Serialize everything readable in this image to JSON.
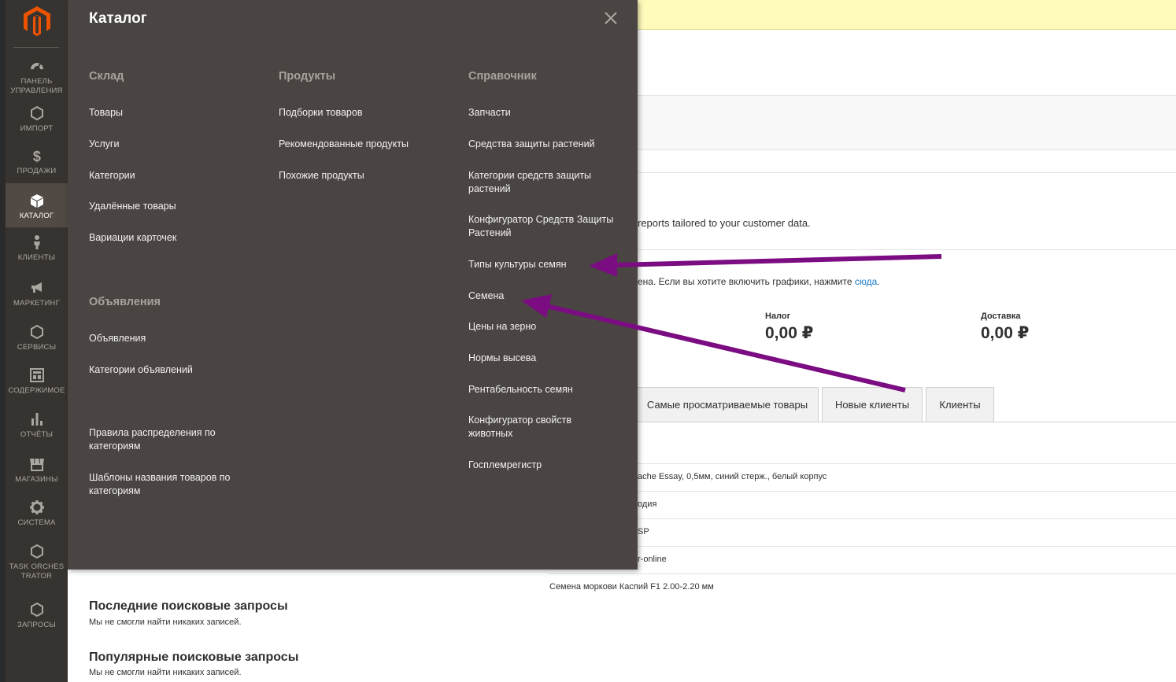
{
  "sidebar": {
    "logo_icon": "magento-logo-icon",
    "items": [
      {
        "label": "Панель управления",
        "icon": "dashboard-icon"
      },
      {
        "label": "Импорт",
        "icon": "hexagon-icon"
      },
      {
        "label": "Продажи",
        "icon": "dollar-icon"
      },
      {
        "label": "Каталог",
        "icon": "box-icon",
        "active": true
      },
      {
        "label": "Клиенты",
        "icon": "person-icon"
      },
      {
        "label": "Маркетинг",
        "icon": "megaphone-icon"
      },
      {
        "label": "Сервисы",
        "icon": "hexagon-icon"
      },
      {
        "label": "Содержимое",
        "icon": "layout-icon"
      },
      {
        "label": "Отчёты",
        "icon": "bar-chart-icon"
      },
      {
        "label": "Магазины",
        "icon": "store-icon"
      },
      {
        "label": "Система",
        "icon": "gear-icon"
      },
      {
        "label": "Task Orchestrator",
        "icon": "hexagon-icon"
      },
      {
        "label": "Запросы",
        "icon": "hexagon-icon"
      }
    ],
    "accent_color": "#eb5202"
  },
  "flyout": {
    "title": "Каталог",
    "close_icon": "close-icon",
    "columns": [
      {
        "heading": "Склад",
        "links": [
          "Товары",
          "Услуги",
          "Категории",
          "Удалённые товары",
          "Вариации карточек"
        ]
      },
      {
        "heading": "Продукты",
        "links": [
          "Подборки товаров",
          "Рекомендованные продукты",
          "Похожие продукты"
        ]
      },
      {
        "heading": "Справочник",
        "links": [
          "Запчасти",
          "Средства защиты растений",
          "Категории средств защиты растений",
          "Конфигуратор Средств Защиты Растений",
          "Типы культуры семян",
          "Семена",
          "Цены на зерно",
          "Нормы высева",
          "Рентабельность семян",
          "Конфигуратор свойств животных",
          "Госплемрегистр"
        ]
      }
    ],
    "ads": {
      "heading": "Объявления",
      "links": [
        "Объявления",
        "Категории объявлений"
      ]
    },
    "extra_links": [
      "Правила распределения по категориям",
      "Шаблоны названия товаров по категориям"
    ]
  },
  "dashboard": {
    "reports_text": "reports tailored to your customer data.",
    "charts_notice_prefix": "ена. Если вы хотите включить графики, нажмите ",
    "charts_notice_link": "сюда",
    "charts_notice_suffix": ".",
    "stats": [
      {
        "label": "Налог",
        "value": "0,00 ₽"
      },
      {
        "label": "Доставка",
        "value": "0,00 ₽"
      }
    ],
    "tabs": [
      "Самые просматриваемые товары",
      "Новые клиенты",
      "Клиенты"
    ],
    "rows": [
      "ache Essay, 0,5мм, синий стерж., белый корпус",
      "одия",
      "SP",
      "r-online",
      "Семена моркови Каспий F1 2.00-2.20 мм"
    ],
    "last_search_title": "Последние поисковые запросы",
    "last_search_empty": "Мы не смогли найти никаких записей.",
    "popular_search_title": "Популярные поисковые запросы",
    "popular_search_empty": "Мы не смогли найти никаких записей."
  },
  "annotation_color": "#7b0c82"
}
